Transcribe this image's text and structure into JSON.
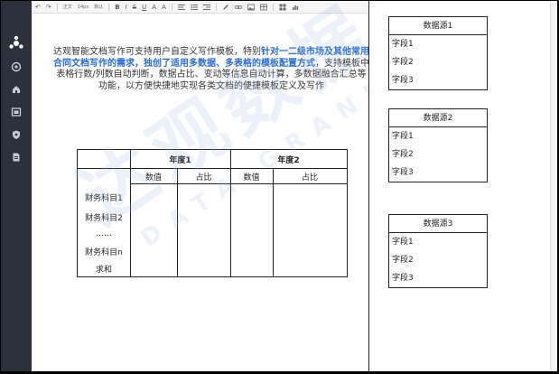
{
  "toolbar": {
    "undo_label": "↶",
    "redo_label": "↷",
    "font_family": "正文",
    "font_size": "14px",
    "paragraph": "默认",
    "bold_label": "B",
    "italic_label": "I",
    "strike_label": "S",
    "underline_label": "U",
    "font_color_label": "A",
    "highlight_label": "A"
  },
  "document": {
    "intro_plain_1": "达观智能文档写作可支持用户自定义写作模板，特别",
    "intro_highlight": "针对一二级市场及其他常用合同文档写作的需求，独创了适用多数据、多表格的模板配置方式",
    "intro_plain_2": "，支持模板中表格行数/列数自动判断，数据占比、变动等信息自动计算，多数据融合汇总等功能，以方便快捷地实现各类文档的便捷模板定义及写作",
    "highlight_color": "#2a6cd6",
    "table": {
      "year1": "年度1",
      "year2": "年度2",
      "value_label": "数值",
      "ratio_label": "占比",
      "rows": [
        "财务科目1",
        "财务科目2",
        "……",
        "财务科目n",
        "求和"
      ]
    }
  },
  "watermark": {
    "main": "达观数据",
    "sub": "DATA GRAND"
  },
  "sources": [
    {
      "title": "数据源1",
      "fields": [
        "字段1",
        "字段2",
        "字段3"
      ]
    },
    {
      "title": "数据源2",
      "fields": [
        "字段1",
        "字段2",
        "字段3"
      ]
    },
    {
      "title": "数据源3",
      "fields": [
        "字段1",
        "字段2",
        "字段3"
      ]
    }
  ],
  "sidebar": {
    "icons": [
      "logo-icon",
      "globe-icon",
      "home-icon",
      "image-icon",
      "shield-icon",
      "document-icon"
    ]
  }
}
